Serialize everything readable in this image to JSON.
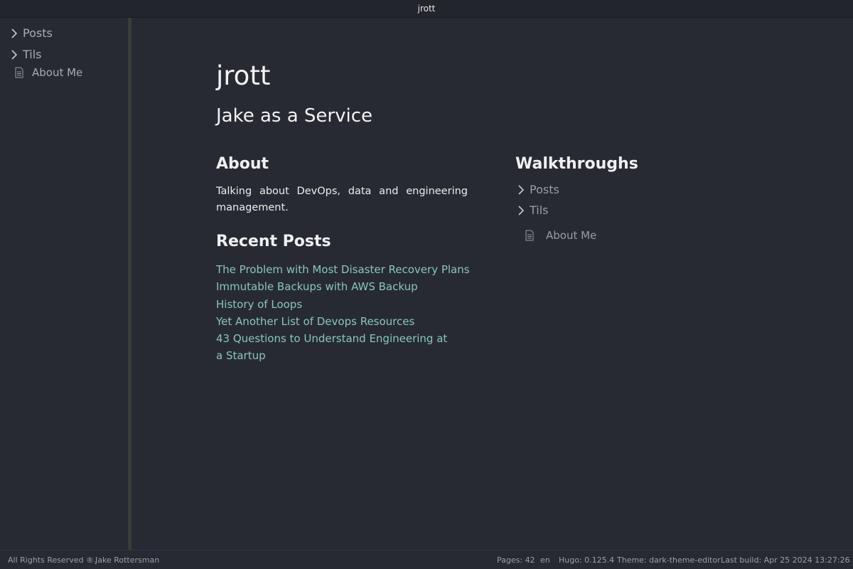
{
  "window": {
    "title": "jrott"
  },
  "sidebar": {
    "items": [
      {
        "label": "Posts",
        "icon": "chevron-right-icon"
      },
      {
        "label": "Tils",
        "icon": "chevron-right-icon"
      },
      {
        "label": "About Me",
        "icon": "file-icon"
      }
    ]
  },
  "main": {
    "site_title": "jrott",
    "subtitle": "Jake as a Service",
    "about": {
      "heading": "About",
      "text": "Talking about DevOps, data and engineering management."
    },
    "recent_posts": {
      "heading": "Recent Posts",
      "items": [
        "The Problem with Most Disaster Recovery Plans",
        "Immutable Backups with AWS Backup",
        "History of Loops",
        "Yet Another List of Devops Resources",
        "43 Questions to Understand Engineering at a Startup"
      ]
    },
    "walkthroughs": {
      "heading": "Walkthroughs",
      "items": [
        {
          "label": "Posts",
          "icon": "chevron-right-icon"
        },
        {
          "label": "Tils",
          "icon": "chevron-right-icon"
        },
        {
          "label": "About Me",
          "icon": "file-icon"
        }
      ]
    }
  },
  "footer": {
    "copyright": "All Rights Reserved ®.",
    "author": "Jake Rottersman",
    "pages": "Pages: 42",
    "lang": "en",
    "hugo": "Hugo: 0.125.4",
    "theme": "Theme: dark-theme-editor",
    "last_build": "Last build:  Apr 25 2024 13:27:26"
  },
  "colors": {
    "background": "#282a33",
    "link": "#86c7bb",
    "muted": "#a9abb0",
    "splitter": "#3a3c3a"
  }
}
